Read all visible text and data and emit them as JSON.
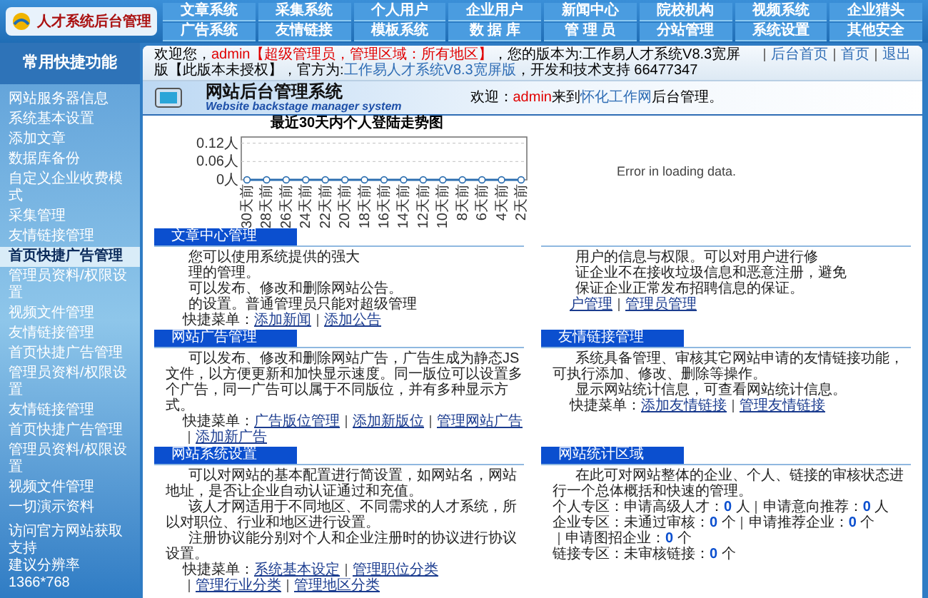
{
  "logo": {
    "text": "人才系统后台管理"
  },
  "nav": [
    "文章系统",
    "采集系统",
    "个人用户",
    "企业用户",
    "新闻中心",
    "院校机构",
    "视频系统",
    "企业猎头",
    "广告系统",
    "友情链接",
    "模板系统",
    "数 据 库",
    "管 理 员",
    "分站管理",
    "系统设置",
    "其他安全"
  ],
  "sidebar": {
    "title": "常用快捷功能",
    "items": [
      {
        "label": "网站服务器信息",
        "selected": false
      },
      {
        "label": "系统基本设置",
        "selected": false
      },
      {
        "label": "添加文章",
        "selected": false
      },
      {
        "label": "数据库备份",
        "selected": false
      },
      {
        "label": "自定义企业收费模式",
        "selected": false
      },
      {
        "label": "采集管理",
        "selected": false
      },
      {
        "label": "友情链接管理",
        "selected": false
      },
      {
        "label": "首页快捷广告管理",
        "selected": true
      },
      {
        "label": "管理员资料/权限设置",
        "selected": false
      },
      {
        "label": "视频文件管理",
        "selected": false
      },
      {
        "label": "友情链接管理",
        "selected": false
      },
      {
        "label": "首页快捷广告管理",
        "selected": false
      },
      {
        "label": "管理员资料/权限设置",
        "selected": false
      },
      {
        "label": "友情链接管理",
        "selected": false
      },
      {
        "label": "首页快捷广告管理",
        "selected": false
      },
      {
        "label": "管理员资料/权限设置",
        "selected": false
      },
      {
        "label": "视频文件管理",
        "selected": false
      },
      {
        "label": "一切演示资料",
        "selected": false
      }
    ],
    "footer": [
      "访问官方网站获取支持",
      "建议分辨率 1366*768"
    ]
  },
  "info_bar": {
    "segments": [
      {
        "text": "欢迎您，",
        "kind": "plain"
      },
      {
        "text": "admin【超级管理员，管理区域：所有地区】",
        "kind": "alert"
      },
      {
        "text": "，您的版本为:工作易人才系统V8.3宽屏版【此版本未授权】，官方为:",
        "kind": "plain"
      },
      {
        "text": "工作易人才系统V8.3宽屏版",
        "kind": "link"
      },
      {
        "text": "，开发和技术支持 66477347",
        "kind": "plain"
      }
    ],
    "links": [
      "后台首页",
      "首页",
      "退出"
    ]
  },
  "header": {
    "title": "网站后台管理系统",
    "subtitle": "Website backstage manager system",
    "welcome": [
      {
        "text": "欢迎：",
        "kind": "plain"
      },
      {
        "text": "admin",
        "kind": "alert"
      },
      {
        "text": "来到",
        "kind": "plain"
      },
      {
        "text": "怀化工作网",
        "kind": "link"
      },
      {
        "text": "后台管理。",
        "kind": "plain"
      }
    ]
  },
  "chart": {
    "error": "Error in loading data.",
    "chart_data": {
      "type": "line",
      "title": "最近30天内个人登陆走势图",
      "categories": [
        "30天前",
        "28天前",
        "26天前",
        "24天前",
        "22天前",
        "20天前",
        "18天前",
        "16天前",
        "14天前",
        "12天前",
        "10天前",
        "8天前",
        "6天前",
        "4天前",
        "2天前"
      ],
      "series": [
        {
          "color": "#2d6fb0",
          "marker": true,
          "values": [
            0,
            0,
            0,
            0,
            0,
            0,
            0,
            0,
            0,
            0,
            0,
            0,
            0,
            0,
            0
          ]
        }
      ],
      "ylim": [
        0,
        0.14
      ],
      "yticks": [
        {
          "value": 0,
          "label": "0人"
        },
        {
          "value": 0.06,
          "label": "0.06人"
        },
        {
          "value": 0.12,
          "label": "0.12人"
        }
      ]
    }
  },
  "sections": [
    {
      "title": "文章中心管理",
      "paragraphs": [
        "您可以使用系统提供的强大",
        "理的管理。",
        "可以发布、修改和删除网站公告。",
        "的设置。普通管理员只能对超级管理"
      ],
      "quick_label": "快捷菜单：",
      "quick_links": [
        "添加新闻",
        "添加公告"
      ]
    },
    {
      "paragraphs": [
        "用户的信息与权限。可以对用户进行修",
        "证企业不在接收垃圾信息和恶意注册，避免",
        "保证企业正常发布招聘信息的保证。"
      ],
      "quick_links": [
        "户管理",
        "管理员管理"
      ]
    },
    {
      "title": "网站广告管理",
      "paragraphs": [
        "可以发布、修改和删除网站广告，广告生成为静态JS文件，以方便更新和加快显示速度。同一版位可以设置多个广告，同一广告可以属于不同版位，并有多种显示方式。"
      ],
      "quick_label": "快捷菜单：",
      "quick_links": [
        "广告版位管理",
        "添加新版位",
        "管理网站广告",
        "添加新广告"
      ]
    },
    {
      "title": "友情链接管理",
      "paragraphs": [
        "系统具备管理、审核其它网站申请的友情链接功能，可执行添加、修改、删除等操作。",
        "显示网站统计信息，可查看网站统计信息。"
      ],
      "quick_label": "快捷菜单：",
      "quick_links": [
        "添加友情链接",
        "管理友情链接"
      ]
    },
    {
      "title": "网站系统设置",
      "paragraphs": [
        "可以对网站的基本配置进行简设置，如网站名，网站地址，是否让企业自动认证通过和充值。",
        "该人才网适用于不同地区、不同需求的人才系统，所以对职位、行业和地区进行设置。",
        "注册协议能分别对个人和企业注册时的协议进行协议设置。"
      ],
      "quick_label": "快捷菜单：",
      "quick_links": [
        "系统基本设定",
        "管理职位分类",
        "管理行业分类",
        "管理地区分类"
      ]
    },
    {
      "title": "网站统计区域",
      "paragraphs": [
        "在此可对网站整体的企业、个人、链接的审核状态进行一个总体概括和快速的管理。"
      ],
      "stats": [
        {
          "label": "个人专区：",
          "items": [
            {
              "label": "申请高级人才：",
              "count": "0",
              "unit": "人"
            },
            {
              "label": "申请意向推荐：",
              "count": "0",
              "unit": "人"
            }
          ]
        },
        {
          "label": "企业专区：",
          "items": [
            {
              "label": "未通过审核：",
              "count": "0",
              "unit": "个"
            },
            {
              "label": "申请推荐企业：",
              "count": "0",
              "unit": "个"
            },
            {
              "label": "申请图招企业：",
              "count": "0",
              "unit": "个"
            }
          ]
        },
        {
          "label": "链接专区：",
          "items": [
            {
              "label": "未审核链接：",
              "count": "0",
              "unit": "个"
            }
          ]
        }
      ]
    }
  ]
}
